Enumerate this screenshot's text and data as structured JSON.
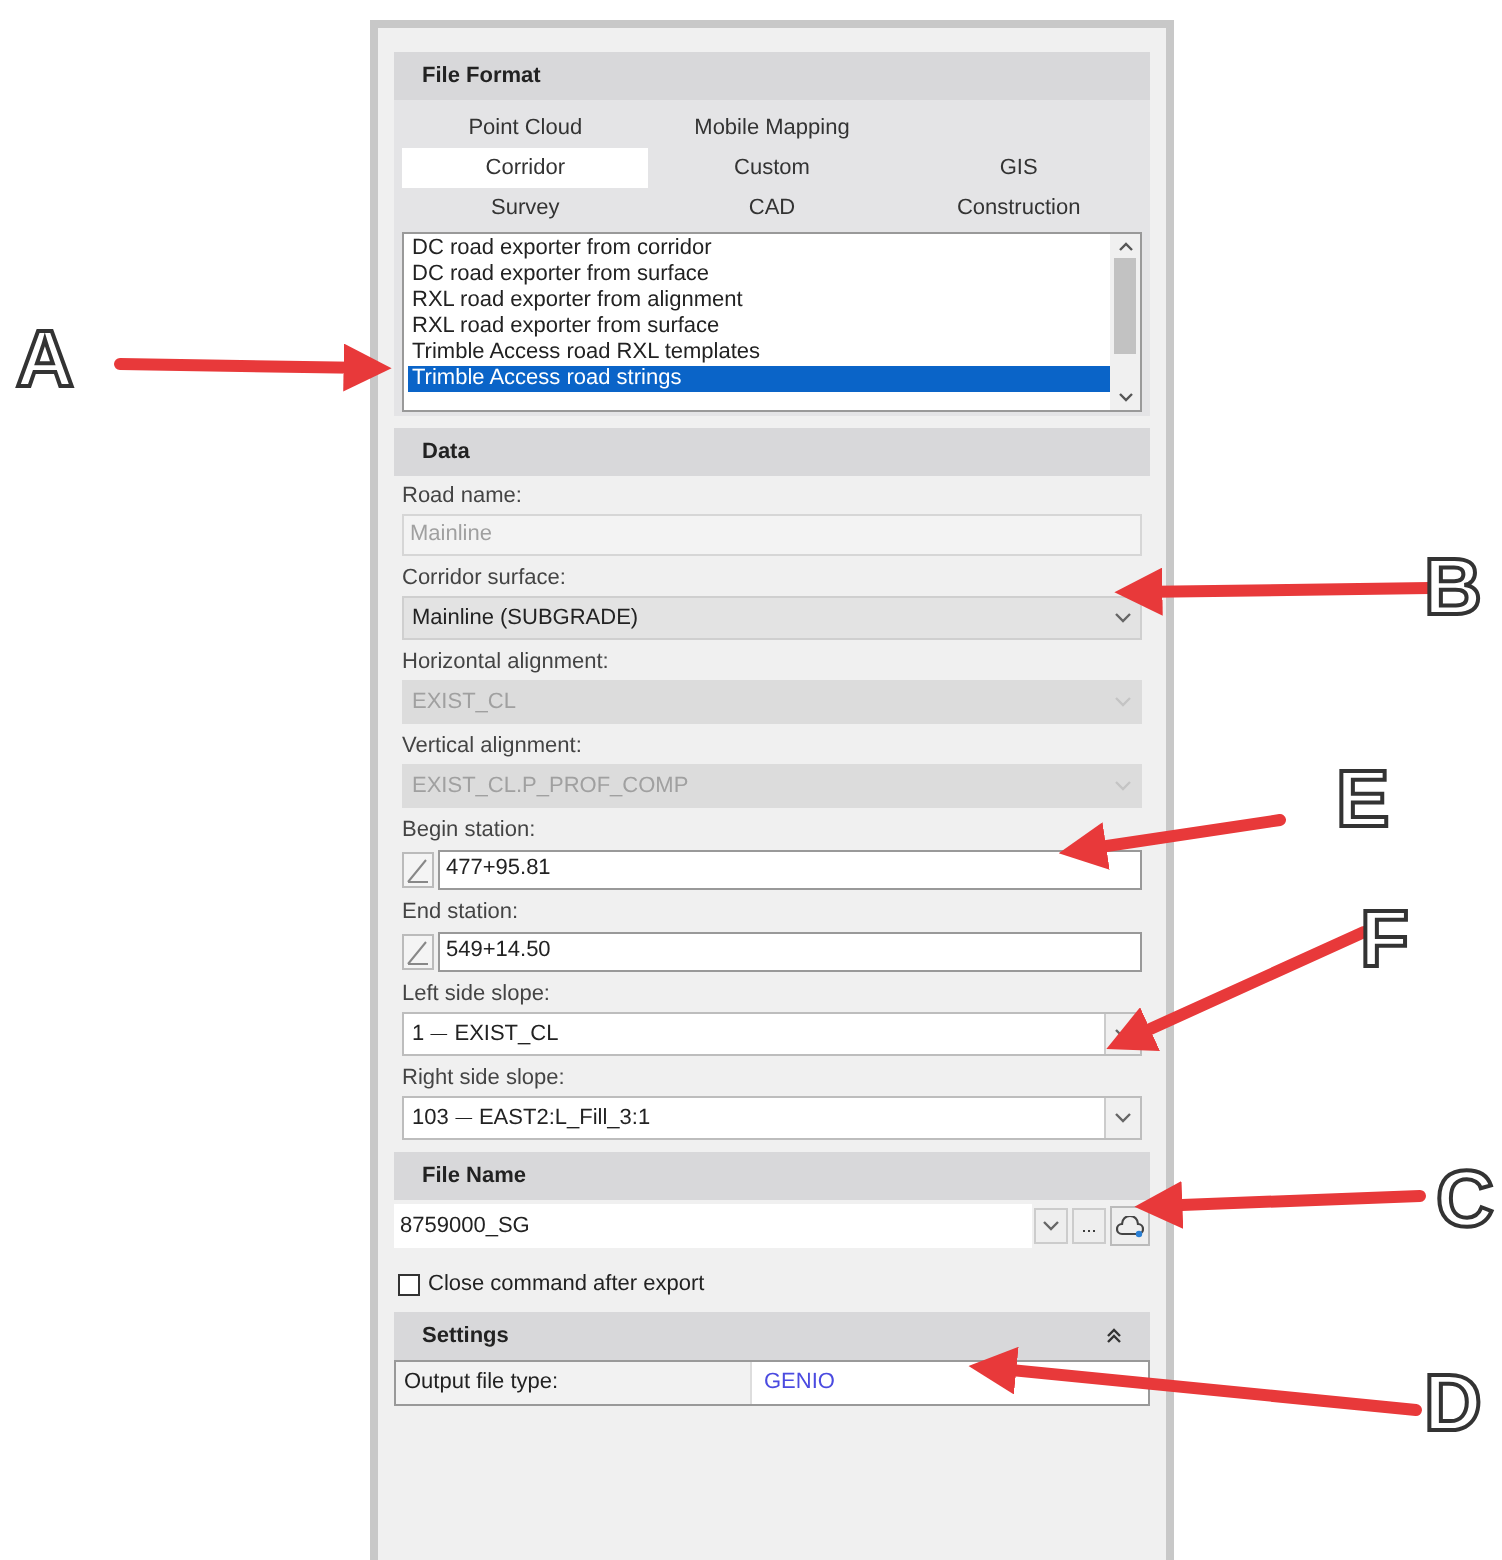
{
  "panel": {
    "file_format": {
      "title": "File Format",
      "tab_rows": [
        [
          {
            "label": "Point Cloud",
            "selected": false
          },
          {
            "label": "Mobile Mapping",
            "selected": false
          }
        ],
        [
          {
            "label": "Corridor",
            "selected": true
          },
          {
            "label": "Custom",
            "selected": false
          },
          {
            "label": "GIS",
            "selected": false
          }
        ],
        [
          {
            "label": "Survey",
            "selected": false
          },
          {
            "label": "CAD",
            "selected": false
          },
          {
            "label": "Construction",
            "selected": false
          }
        ]
      ],
      "exporters": [
        {
          "label": "DC road exporter from corridor",
          "selected": false
        },
        {
          "label": "DC road exporter from surface",
          "selected": false
        },
        {
          "label": "RXL road exporter from alignment",
          "selected": false
        },
        {
          "label": "RXL road exporter from surface",
          "selected": false
        },
        {
          "label": "Trimble Access road RXL templates",
          "selected": false
        },
        {
          "label": "Trimble Access road strings",
          "selected": true
        }
      ]
    },
    "data": {
      "title": "Data",
      "fields": [
        {
          "kind": "text",
          "label": "Road name:",
          "value": "Mainline",
          "disabled": true
        },
        {
          "kind": "combo",
          "label": "Corridor surface:",
          "value": "Mainline (SUBGRADE)",
          "disabled": false,
          "flat": true
        },
        {
          "kind": "combo",
          "label": "Horizontal alignment:",
          "value": "EXIST_CL",
          "disabled": true,
          "flat": true
        },
        {
          "kind": "combo",
          "label": "Vertical alignment:",
          "value": "EXIST_CL.P_PROF_COMP",
          "disabled": true,
          "flat": true
        },
        {
          "kind": "station",
          "label": "Begin station:",
          "value": "477+95.81",
          "disabled": false
        },
        {
          "kind": "station",
          "label": "End station:",
          "value": "549+14.50",
          "disabled": false
        },
        {
          "kind": "combo",
          "label": "Left side slope:",
          "value": "1 ⏤ EXIST_CL",
          "disabled": false,
          "flat": false
        },
        {
          "kind": "combo",
          "label": "Right side slope:",
          "value": "103 ⏤ EAST2:L_Fill_3:1",
          "disabled": false,
          "flat": false
        }
      ]
    },
    "file_name": {
      "title": "File Name",
      "value": "8759000_SG",
      "browse": "..."
    },
    "close_after_export": {
      "label": "Close command after export",
      "checked": false
    },
    "settings": {
      "title": "Settings",
      "expanded": true,
      "rows": [
        {
          "label": "Output file type:",
          "value": "GENIO"
        }
      ]
    }
  },
  "annotations": [
    {
      "label": "A"
    },
    {
      "label": "B"
    },
    {
      "label": "E"
    },
    {
      "label": "F"
    },
    {
      "label": "C"
    },
    {
      "label": "D"
    }
  ]
}
